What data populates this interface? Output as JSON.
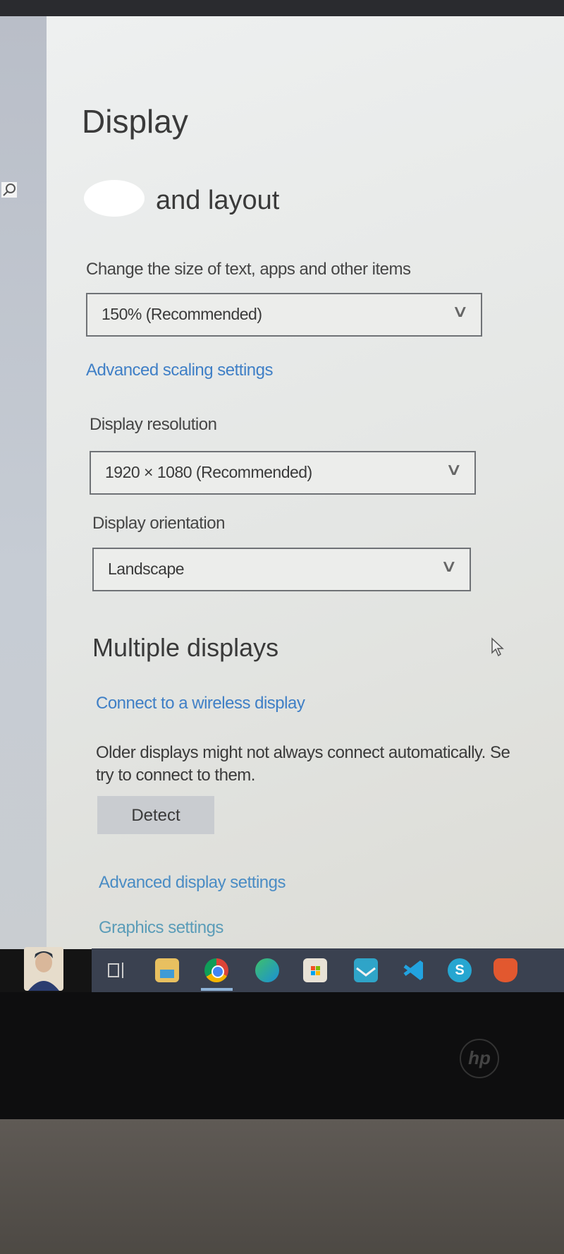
{
  "page": {
    "title": "Display",
    "section_title": "and layout",
    "scale": {
      "label": "Change the size of text, apps and other items",
      "value": "150% (Recommended)",
      "link": "Advanced scaling settings"
    },
    "resolution": {
      "label": "Display resolution",
      "value": "1920 × 1080 (Recommended)"
    },
    "orientation": {
      "label": "Display orientation",
      "value": "Landscape"
    },
    "multiple": {
      "title": "Multiple displays",
      "wireless_link": "Connect to a wireless display",
      "note_line1": "Older displays might not always connect automatically. Se",
      "note_line2": "try to connect to them.",
      "detect_label": "Detect"
    },
    "advanced_display_link": "Advanced display settings",
    "graphics_link": "Graphics settings"
  },
  "taskbar": {
    "icons": [
      "task-view-icon",
      "file-explorer-icon",
      "chrome-icon",
      "edge-icon",
      "store-icon",
      "mail-icon",
      "vscode-icon",
      "skype-icon",
      "brave-icon"
    ],
    "active": "chrome-icon"
  },
  "brand": {
    "laptop_logo": "hp"
  }
}
